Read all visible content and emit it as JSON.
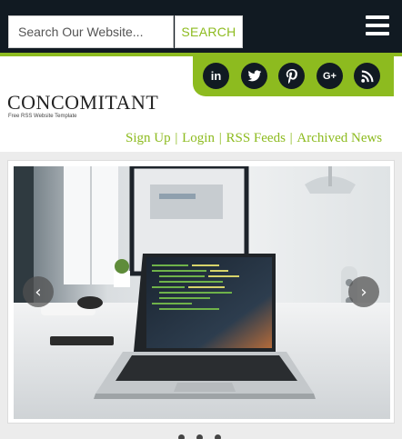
{
  "header": {
    "search": {
      "placeholder": "Search Our Website...",
      "button_label": "SEARCH"
    },
    "menu_icon": "hamburger-icon"
  },
  "social": {
    "icons": [
      {
        "name": "linkedin-icon",
        "glyph": "in"
      },
      {
        "name": "twitter-icon",
        "glyph": "t"
      },
      {
        "name": "pinterest-icon",
        "glyph": "p"
      },
      {
        "name": "google-plus-icon",
        "glyph": "G+"
      },
      {
        "name": "rss-icon",
        "glyph": "rss"
      }
    ]
  },
  "brand": {
    "logo": "CONCOMITANT",
    "tagline": "Free RSS Website Template"
  },
  "nav": {
    "links": [
      "Sign Up",
      "Login",
      "RSS Feeds",
      "Archived News"
    ],
    "separator": " | "
  },
  "slider": {
    "prev_icon": "chevron-left-icon",
    "next_icon": "chevron-right-icon",
    "slide_image": "laptop-on-desk-photo",
    "dots_count": 3
  },
  "colors": {
    "accent": "#8dbb1f",
    "dark": "#111a22",
    "background": "#ffffff",
    "band": "#ececec"
  }
}
